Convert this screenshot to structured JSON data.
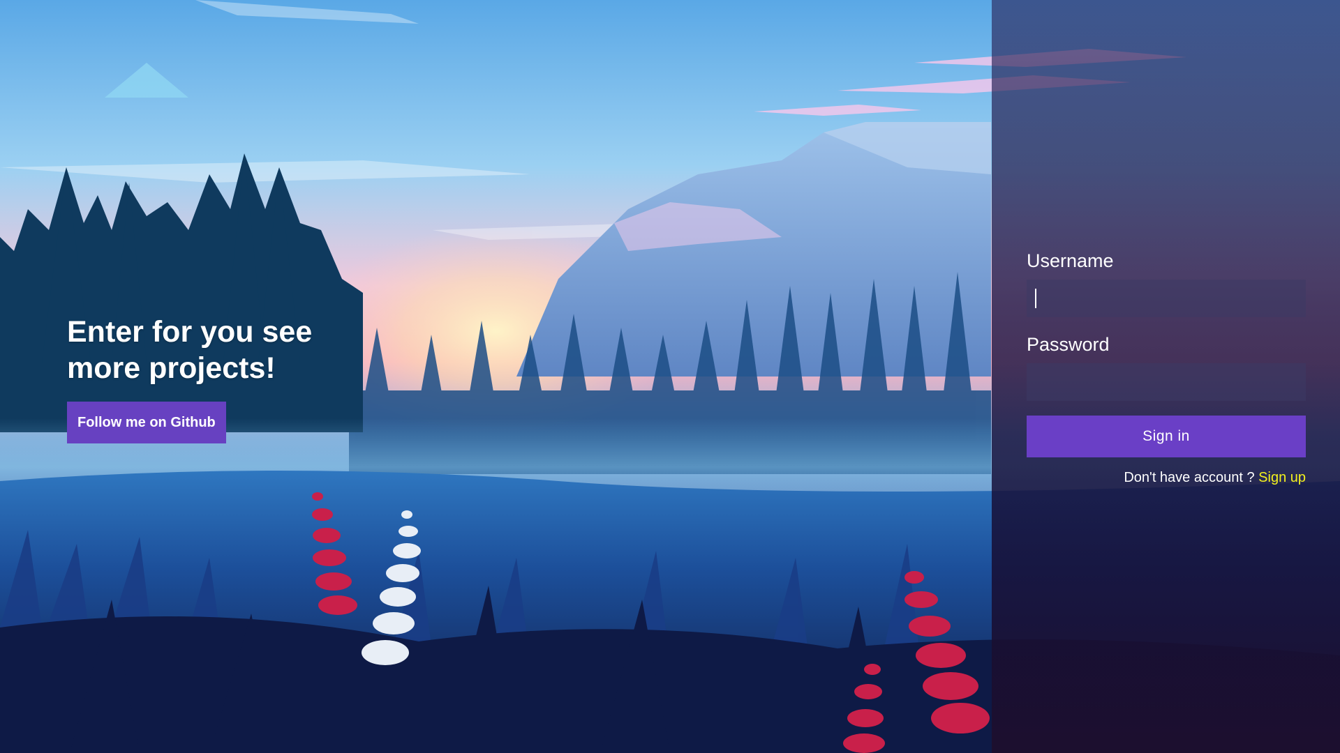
{
  "hero": {
    "title": "Enter for you see more projects!",
    "github_button": "Follow me on Github"
  },
  "login": {
    "username_label": "Username",
    "username_value": "",
    "password_label": "Password",
    "password_value": "",
    "signin_button": "Sign in",
    "signup_prompt": "Don't have account ? ",
    "signup_link": "Sign up"
  },
  "colors": {
    "accent": "#6741c1",
    "link": "#f3f11e",
    "panel": "#1e1646"
  }
}
